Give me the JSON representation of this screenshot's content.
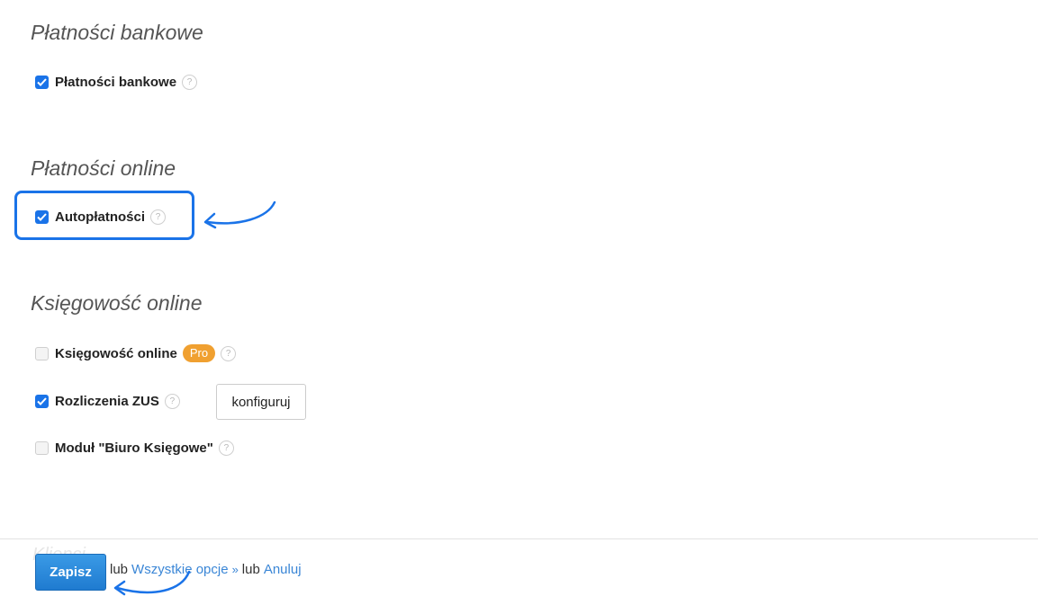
{
  "sections": {
    "bank": {
      "title": "Płatności bankowe",
      "options": [
        {
          "label": "Płatności bankowe",
          "checked": true,
          "help": "?"
        }
      ]
    },
    "online_payments": {
      "title": "Płatności online",
      "options": [
        {
          "label": "Autopłatności",
          "checked": true,
          "help": "?"
        }
      ]
    },
    "accounting": {
      "title": "Księgowość online",
      "options": [
        {
          "label": "Księgowość online",
          "checked": false,
          "badge": "Pro",
          "help": "?"
        },
        {
          "label": "Rozliczenia ZUS",
          "checked": true,
          "help": "?",
          "button": "konfiguruj"
        },
        {
          "label": "Moduł \"Biuro Księgowe\"",
          "checked": false,
          "help": "?"
        }
      ]
    }
  },
  "footer": {
    "ghost_title": "Klienci",
    "save_label": "Zapisz",
    "or_1": "lub",
    "all_options_link": "Wszystkie opcje",
    "raquo": "»",
    "or_2": "lub",
    "cancel_link": "Anuluj"
  },
  "colors": {
    "accent": "#1a73e8",
    "pro_badge": "#f0a030",
    "link": "#3a86d6"
  }
}
